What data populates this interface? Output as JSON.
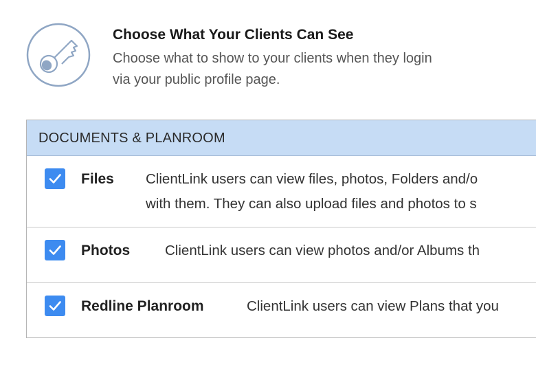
{
  "header": {
    "icon": "key-icon",
    "title": "Choose What Your Clients Can See",
    "subtitle_line1": "Choose what to show to your clients when they login",
    "subtitle_line2": "via your public profile page."
  },
  "section": {
    "title": "DOCUMENTS & PLANROOM",
    "options": [
      {
        "label": "Files",
        "checked": true,
        "desc_line1": "ClientLink users can view files, photos, Folders and/o",
        "desc_line2": "with them. They can also upload files and photos to s"
      },
      {
        "label": "Photos",
        "checked": true,
        "desc_line1": "ClientLink users can view photos and/or Albums th"
      },
      {
        "label": "Redline Planroom",
        "checked": true,
        "desc_line1": "ClientLink users can view Plans that you"
      }
    ]
  },
  "colors": {
    "accent": "#3d8bf0",
    "section_header_bg": "#c6dcf5",
    "icon_stroke": "#8fa6c4"
  }
}
